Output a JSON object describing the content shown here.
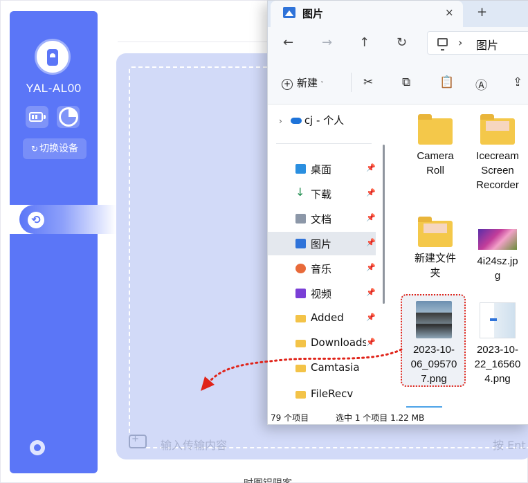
{
  "app": {
    "device_name": "YAL-AL00",
    "switch_device_label": "切换设备",
    "input_placeholder": "输入传输内容",
    "input_hint": "按 Ent",
    "bottom_label": "时图铝限客"
  },
  "explorer": {
    "tab_title": "图片",
    "tab_close": "×",
    "tab_new": "+",
    "nav": {
      "back": "←",
      "forward": "→",
      "up": "↑",
      "refresh": "↻"
    },
    "address": {
      "sep": "›",
      "location": "图片",
      "sep2": "›"
    },
    "toolbar": {
      "new_label": "新建",
      "new_caret": "˅",
      "cut": "✂",
      "copy": "⧉",
      "paste": "📋",
      "rename": "Ⓐ",
      "share": "⇪"
    },
    "onedrive_label": "cj - 个人",
    "nav_items": [
      {
        "label": "桌面",
        "pin": "📌"
      },
      {
        "label": "下载",
        "pin": "📌"
      },
      {
        "label": "文档",
        "pin": "📌"
      },
      {
        "label": "图片",
        "pin": "📌"
      },
      {
        "label": "音乐",
        "pin": "📌"
      },
      {
        "label": "视频",
        "pin": "📌"
      },
      {
        "label": "Added",
        "pin": "📌"
      },
      {
        "label": "Downloads",
        "pin": "📌"
      },
      {
        "label": "Camtasia",
        "pin": ""
      },
      {
        "label": "FileRecv",
        "pin": ""
      }
    ],
    "files": [
      {
        "name_l1": "Camera",
        "name_l2": "Roll",
        "name_l3": ""
      },
      {
        "name_l1": "Icecream",
        "name_l2": "Screen",
        "name_l3": "Recorder"
      },
      {
        "name_l1": "新建文件",
        "name_l2": "夹",
        "name_l3": ""
      },
      {
        "name_l1": "4i24sz.jp",
        "name_l2": "g",
        "name_l3": ""
      },
      {
        "name_l1": "2023-10-",
        "name_l2": "06_09570",
        "name_l3": "7.png"
      },
      {
        "name_l1": "2023-10-",
        "name_l2": "22_16560",
        "name_l3": "4.png"
      }
    ],
    "status": {
      "count": "79 个项目",
      "selected": "选中 1 个项目  1.22 MB"
    }
  },
  "colors": {
    "accent": "#5b76f7",
    "drop_zone": "#d2daf8",
    "drag_arrow": "#e0241a"
  }
}
